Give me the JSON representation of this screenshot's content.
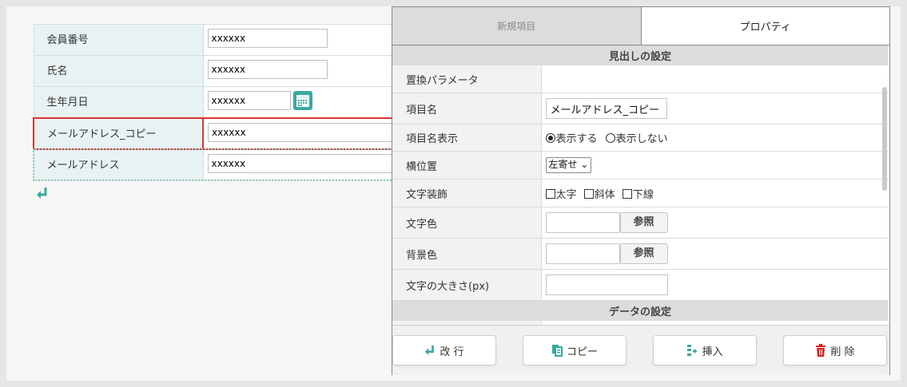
{
  "form": {
    "rows": [
      {
        "label": "会員番号",
        "value": "xxxxxx"
      },
      {
        "label": "氏名",
        "value": "xxxxxx"
      },
      {
        "label": "生年月日",
        "value": "xxxxxx"
      },
      {
        "label": "メールアドレス_コピー",
        "value": "xxxxxx"
      },
      {
        "label": "メールアドレス",
        "value": "xxxxxx"
      }
    ]
  },
  "panel": {
    "tabs": {
      "new_item": "新規項目",
      "properties": "プロパティ"
    },
    "sections": {
      "heading_settings": "見出しの設定",
      "data_settings": "データの設定"
    },
    "props": {
      "replace_param": "置換パラメータ",
      "item_name": "項目名",
      "item_name_value": "メールアドレス_コピー",
      "item_name_display": "項目名表示",
      "show": "表示する",
      "hide": "表示しない",
      "horizontal_pos": "横位置",
      "align_value": "左寄せ",
      "text_deco": "文字装飾",
      "bold": "太字",
      "italic": "斜体",
      "underline": "下線",
      "text_color": "文字色",
      "bg_color": "背景色",
      "ref": "参照",
      "font_size": "文字の大きさ(px)"
    },
    "footer": {
      "newline": "改 行",
      "copy": "コピー",
      "insert": "挿入",
      "delete": "削 除"
    }
  },
  "colors": {
    "accent": "#3aa89d",
    "selected": "#dd3333",
    "delete": "#d82020"
  }
}
